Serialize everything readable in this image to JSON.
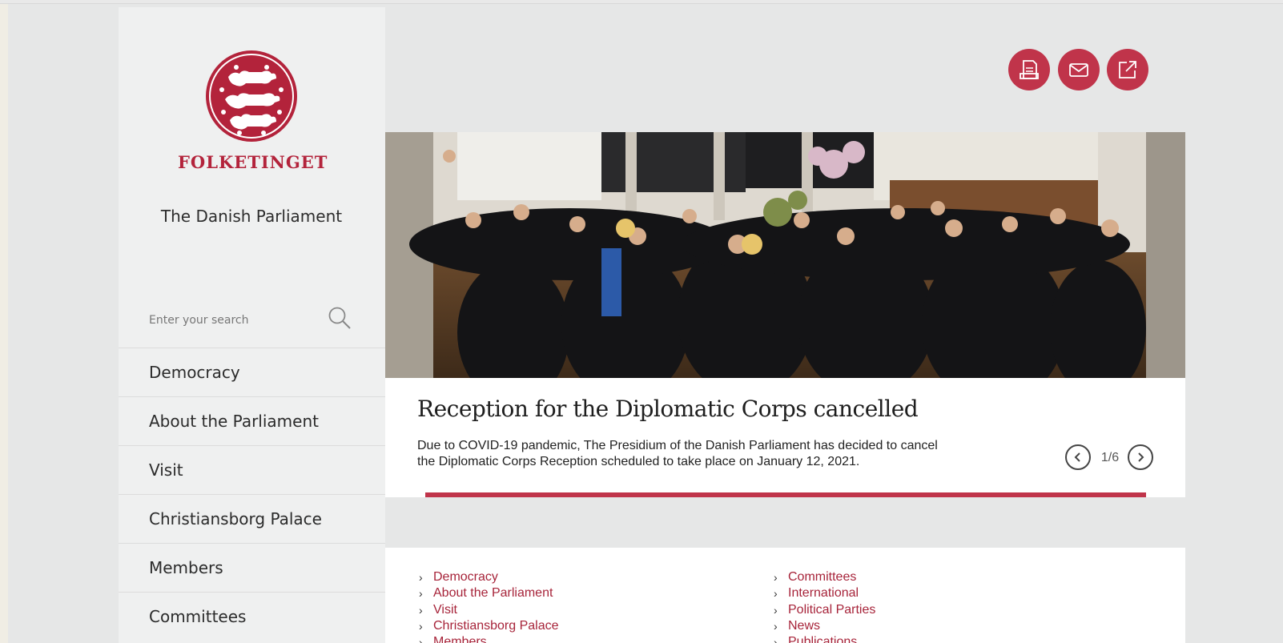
{
  "brand": {
    "wordmark": "FOLKETINGET",
    "tagline": "The Danish Parliament",
    "accent": "#c0344a",
    "seal_color": "#b3233b"
  },
  "search": {
    "placeholder": "Enter your search",
    "icon": "search-icon"
  },
  "nav": {
    "items": [
      "Democracy",
      "About the Parliament",
      "Visit",
      "Christiansborg Palace",
      "Members",
      "Committees"
    ]
  },
  "tools": [
    {
      "name": "print-icon"
    },
    {
      "name": "mail-icon"
    },
    {
      "name": "share-icon"
    }
  ],
  "hero": {
    "title": "Reception for the Diplomatic Corps cancelled",
    "text": "Due to COVID-19 pandemic, The Presidium of the Danish Parliament has decided to cancel the Diplomatic Corps Reception scheduled to take place on January 12, 2021.",
    "pager": "1/6",
    "progress": 1.0
  },
  "footer_links": {
    "col1": [
      "Democracy",
      "About the Parliament",
      "Visit",
      "Christiansborg Palace",
      "Members"
    ],
    "col2": [
      "Committees",
      "International",
      "Political Parties",
      "News",
      "Publications"
    ]
  }
}
